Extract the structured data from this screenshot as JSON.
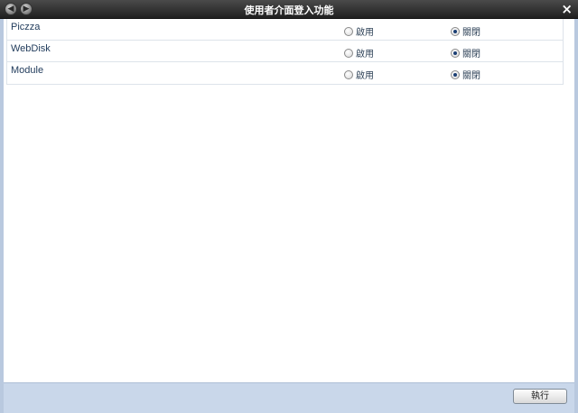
{
  "window": {
    "title": "使用者介面登入功能",
    "close_label": "×"
  },
  "rows": [
    {
      "name": "Piczza",
      "enable_label": "啟用",
      "disable_label": "關閉",
      "selected": "disable"
    },
    {
      "name": "WebDisk",
      "enable_label": "啟用",
      "disable_label": "關閉",
      "selected": "disable"
    },
    {
      "name": "Module",
      "enable_label": "啟用",
      "disable_label": "關閉",
      "selected": "disable"
    }
  ],
  "footer": {
    "execute_label": "執行"
  }
}
